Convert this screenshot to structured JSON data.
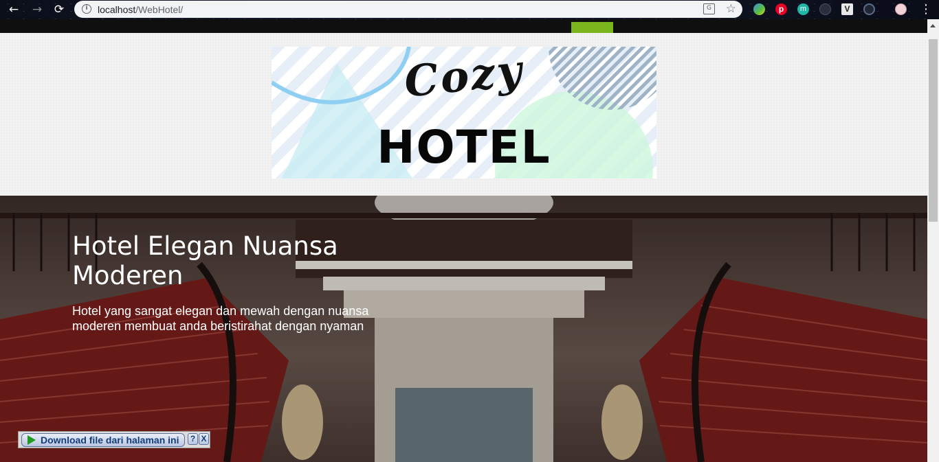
{
  "browser": {
    "url_host": "localhost",
    "url_path": "/WebHotel/",
    "extensions": [
      "globe-extension-icon",
      "pinterest-icon",
      "m-extension-icon",
      "ring-extension-icon",
      "v-extension-icon",
      "gear-extension-icon",
      "profile-avatar"
    ]
  },
  "nav": {
    "active_color": "#7ab51d"
  },
  "logo": {
    "script_text": "Cozy",
    "main_text": "HOTEL"
  },
  "hero": {
    "title": "Hotel Elegan Nuansa Moderen",
    "subtitle": "Hotel yang sangat elegan dan mewah dengan nuansa moderen membuat anda beristirahat dengan nyaman"
  },
  "download_bar": {
    "label": "Download file dari halaman ini",
    "help": "?",
    "close": "X"
  }
}
